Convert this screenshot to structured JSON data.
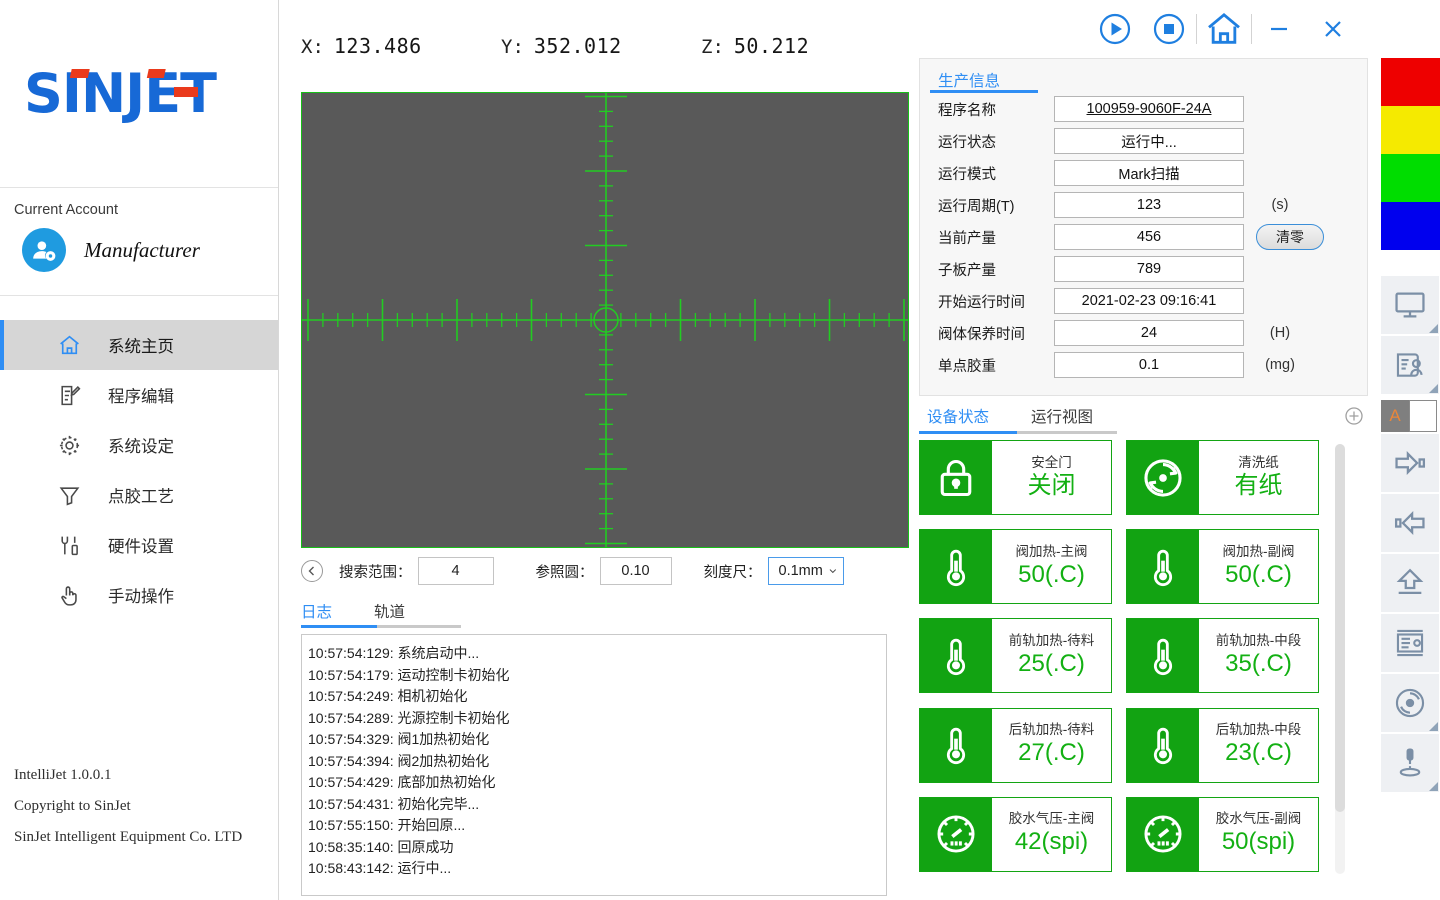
{
  "titlebar": {
    "buttons": [
      {
        "name": "play-button",
        "icon": "play-circle-icon"
      },
      {
        "name": "stop-button",
        "icon": "stop-circle-icon"
      },
      {
        "name": "home-button",
        "icon": "home-icon"
      },
      {
        "name": "minimize-button",
        "icon": "minimize-icon"
      },
      {
        "name": "close-button",
        "icon": "close-icon"
      }
    ]
  },
  "sidebar": {
    "logo": "SINJET",
    "account_label": "Current Account",
    "account_name": "Manufacturer",
    "items": [
      {
        "label": "系统主页",
        "icon": "home-icon",
        "active": true
      },
      {
        "label": "程序编辑",
        "icon": "edit-document-icon",
        "active": false
      },
      {
        "label": "系统设定",
        "icon": "gear-icon",
        "active": false
      },
      {
        "label": "点胶工艺",
        "icon": "funnel-icon",
        "active": false
      },
      {
        "label": "硬件设置",
        "icon": "tools-icon",
        "active": false
      },
      {
        "label": "手动操作",
        "icon": "hand-pointer-icon",
        "active": false
      }
    ],
    "footer": [
      "IntelliJet 1.0.0.1",
      "Copyright to SinJet",
      "SinJet Intelligent Equipment Co. LTD"
    ]
  },
  "coordinates": [
    {
      "axis": "X:",
      "value": "123.486"
    },
    {
      "axis": "Y:",
      "value": "352.012"
    },
    {
      "axis": "Z:",
      "value": "50.212"
    }
  ],
  "viewport": {
    "background_color": "#595959",
    "reticle_color": "#22cc22",
    "border_color": "#18c018"
  },
  "controls": {
    "back_icon": "chevron-left-icon",
    "search_range_label": "搜索范围：",
    "search_range_value": "4",
    "ref_circle_label": "参照圆：",
    "ref_circle_value": "0.10",
    "scale_label": "刻度尺：",
    "scale_value": "0.1mm"
  },
  "log": {
    "tabs": [
      {
        "label": "日志",
        "active": true
      },
      {
        "label": "轨道",
        "active": false
      }
    ],
    "lines": [
      "10:57:54:129: 系统启动中...",
      "10:57:54:179: 运动控制卡初始化",
      "10:57:54:249: 相机初始化",
      "10:57:54:289: 光源控制卡初始化",
      "10:57:54:329: 阀1加热初始化",
      "10:57:54:394: 阀2加热初始化",
      "10:57:54:429: 底部加热初始化",
      "10:57:54:431: 初始化完毕...",
      "10:57:55:150: 开始回原...",
      "10:58:35:140: 回原成功",
      "10:58:43:142: 运行中..."
    ]
  },
  "production": {
    "tab_label": "生产信息",
    "clear_button": "清零",
    "rows": [
      {
        "label": "程序名称",
        "value": "100959-9060F-24A",
        "unit": "",
        "link": true
      },
      {
        "label": "运行状态",
        "value": "运行中...",
        "unit": ""
      },
      {
        "label": "运行模式",
        "value": "Mark扫描",
        "unit": ""
      },
      {
        "label": "运行周期(T)",
        "value": "123",
        "unit": "(s)"
      },
      {
        "label": "当前产量",
        "value": "456",
        "unit": ""
      },
      {
        "label": "子板产量",
        "value": "789",
        "unit": ""
      },
      {
        "label": "开始运行时间",
        "value": "2021-02-23 09:16:41",
        "unit": ""
      },
      {
        "label": "阀体保养时间",
        "value": "24",
        "unit": "(H)"
      },
      {
        "label": "单点胶重",
        "value": "0.1",
        "unit": "(mg)"
      }
    ]
  },
  "device_status": {
    "tabs": [
      {
        "label": "设备状态",
        "active": true
      },
      {
        "label": "运行视图",
        "active": false
      }
    ],
    "add_icon": "plus-circle-icon",
    "tiles": [
      {
        "label": "安全门",
        "value": "关闭",
        "icon": "lock-icon"
      },
      {
        "label": "清洗纸",
        "value": "有纸",
        "icon": "clean-cycle-icon"
      },
      {
        "label": "阀加热-主阀",
        "value": "50(.C)",
        "icon": "thermometer-icon"
      },
      {
        "label": "阀加热-副阀",
        "value": "50(.C)",
        "icon": "thermometer-icon"
      },
      {
        "label": "前轨加热-待料",
        "value": "25(.C)",
        "icon": "thermometer-icon"
      },
      {
        "label": "前轨加热-中段",
        "value": "35(.C)",
        "icon": "thermometer-icon"
      },
      {
        "label": "后轨加热-待料",
        "value": "27(.C)",
        "icon": "thermometer-icon"
      },
      {
        "label": "后轨加热-中段",
        "value": "23(.C)",
        "icon": "thermometer-icon"
      },
      {
        "label": "胶水气压-主阀",
        "value": "42(spi)",
        "icon": "gauge-icon"
      },
      {
        "label": "胶水气压-副阀",
        "value": "50(spi)",
        "icon": "gauge-icon"
      }
    ]
  },
  "toolstrip": {
    "status_colors": [
      "#ee0000",
      "#f5ea00",
      "#00dd00",
      "#0000ee"
    ],
    "buttons": [
      {
        "name": "monitor-button",
        "icon": "monitor-icon"
      },
      {
        "name": "operator-record-button",
        "icon": "document-person-icon"
      },
      {
        "name": "text-color-button",
        "icon": "letter-a-icon",
        "letter": "A"
      },
      {
        "name": "move-right-button",
        "icon": "arrow-right-box-icon"
      },
      {
        "name": "move-left-button",
        "icon": "arrow-left-box-icon"
      },
      {
        "name": "lift-up-button",
        "icon": "arrow-up-line-icon"
      },
      {
        "name": "report-button",
        "icon": "form-document-icon"
      },
      {
        "name": "clean-button",
        "icon": "clean-cycle-icon"
      },
      {
        "name": "dispense-button",
        "icon": "needle-dispense-icon"
      }
    ]
  },
  "colors": {
    "accent": "#2f8ef4",
    "green": "#12a312",
    "green_text": "#13b013",
    "logo_blue": "#1769d6",
    "logo_red": "#ea3a1c"
  }
}
